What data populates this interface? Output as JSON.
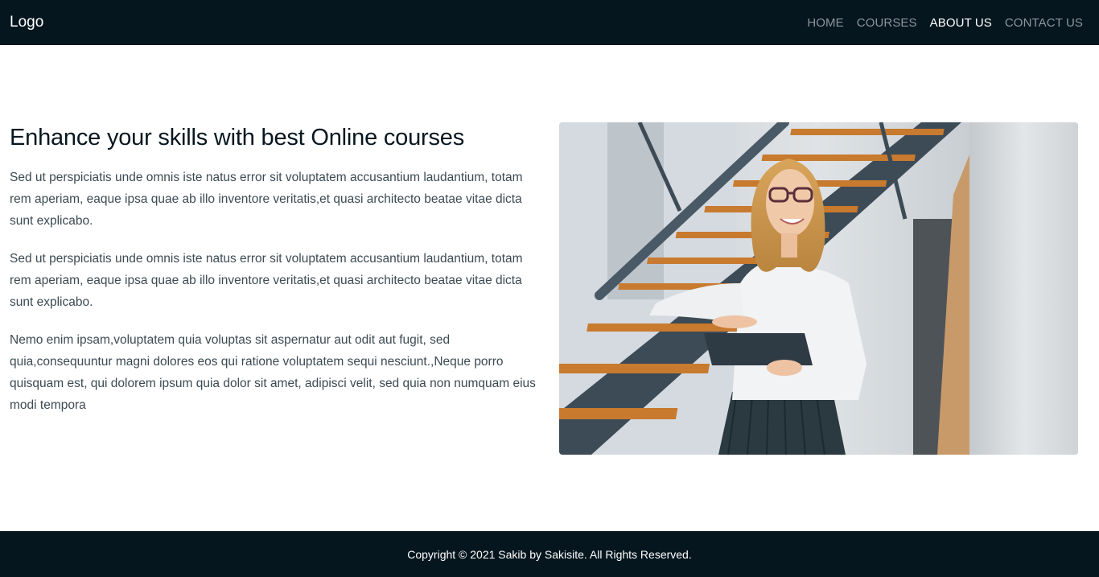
{
  "navbar": {
    "logo": "Logo",
    "links": [
      {
        "label": "HOME"
      },
      {
        "label": "COURSES"
      },
      {
        "label": "ABOUT US"
      },
      {
        "label": "CONTACT US"
      }
    ],
    "active_link": "ABOUT US"
  },
  "main": {
    "title": "Enhance your skills with best Online courses",
    "paragraphs": [
      "Sed ut perspiciatis unde omnis iste natus error sit voluptatem accusantium laudantium, totam rem aperiam, eaque ipsa quae ab illo inventore veritatis,et quasi architecto beatae vitae dicta sunt explicabo.",
      "Sed ut perspiciatis unde omnis iste natus error sit voluptatem accusantium laudantium, totam rem aperiam, eaque ipsa quae ab illo inventore veritatis,et quasi architecto beatae vitae dicta sunt explicabo.",
      "Nemo enim ipsam,voluptatem quia voluptas sit aspernatur aut odit aut fugit, sed quia,consequuntur magni dolores eos qui ratione voluptatem sequi nesciunt.,Neque porro quisquam est, qui dolorem ipsum quia dolor sit amet, adipisci velit, sed quia non numquam eius modi tempora"
    ]
  },
  "footer": {
    "copyright": "Copyright © 2021 Sakib by Sakisite. All Rights Reserved."
  },
  "colors": {
    "dark_bg": "#06161f",
    "nav_inactive": "#8c959b",
    "body_text": "#3c4a52"
  }
}
